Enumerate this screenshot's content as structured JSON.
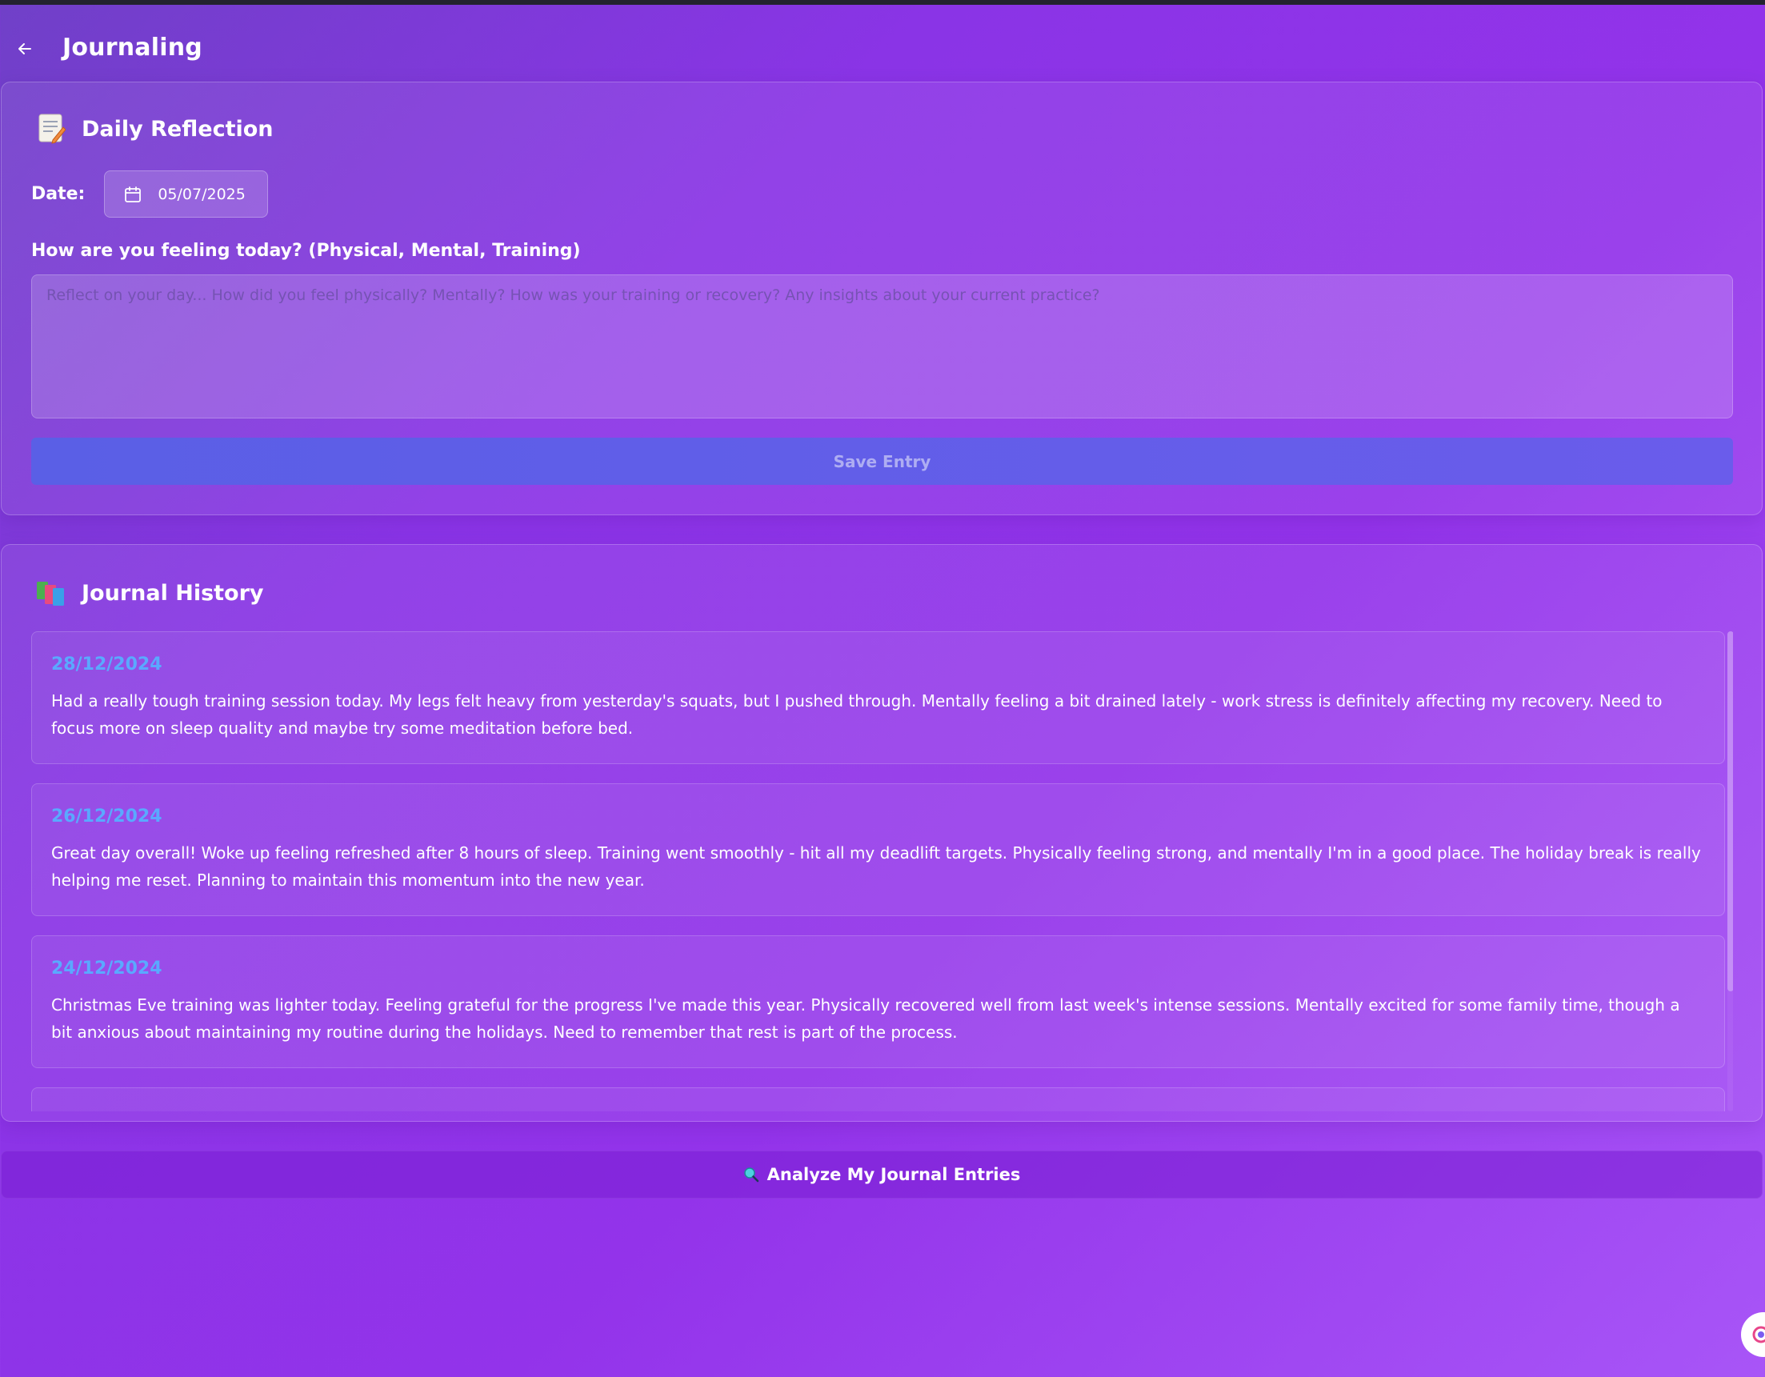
{
  "app": {
    "title": "Journaling",
    "back_icon": "arrow-left-icon"
  },
  "reflection": {
    "title": "Daily Reflection",
    "icon": "memo-icon",
    "date_label": "Date:",
    "date_value": "05/07/2025",
    "question": "How are you feeling today? (Physical, Mental, Training)",
    "placeholder": "Reflect on your day... How did you feel physically? Mentally? How was your training or recovery? Any insights about your current practice?",
    "textarea_value": "",
    "save_label": "Save Entry"
  },
  "history": {
    "title": "Journal History",
    "icon": "books-icon",
    "entries": [
      {
        "date": "28/12/2024",
        "text": "Had a really tough training session today. My legs felt heavy from yesterday's squats, but I pushed through. Mentally feeling a bit drained lately - work stress is definitely affecting my recovery. Need to focus more on sleep quality and maybe try some meditation before bed."
      },
      {
        "date": "26/12/2024",
        "text": "Great day overall! Woke up feeling refreshed after 8 hours of sleep. Training went smoothly - hit all my deadlift targets. Physically feeling strong, and mentally I'm in a good place. The holiday break is really helping me reset. Planning to maintain this momentum into the new year."
      },
      {
        "date": "24/12/2024",
        "text": "Christmas Eve training was lighter today. Feeling grateful for the progress I've made this year. Physically recovered well from last week's intense sessions. Mentally excited for some family time, though a bit anxious about maintaining my routine during the holidays. Need to remember that rest is part of the process."
      }
    ]
  },
  "analyze": {
    "label": "Analyze My Journal Entries",
    "icon": "magnifier-icon"
  },
  "colors": {
    "accent_date": "#5aa9ff",
    "save_button": "#5f5fe8",
    "background": "#9333ea"
  }
}
